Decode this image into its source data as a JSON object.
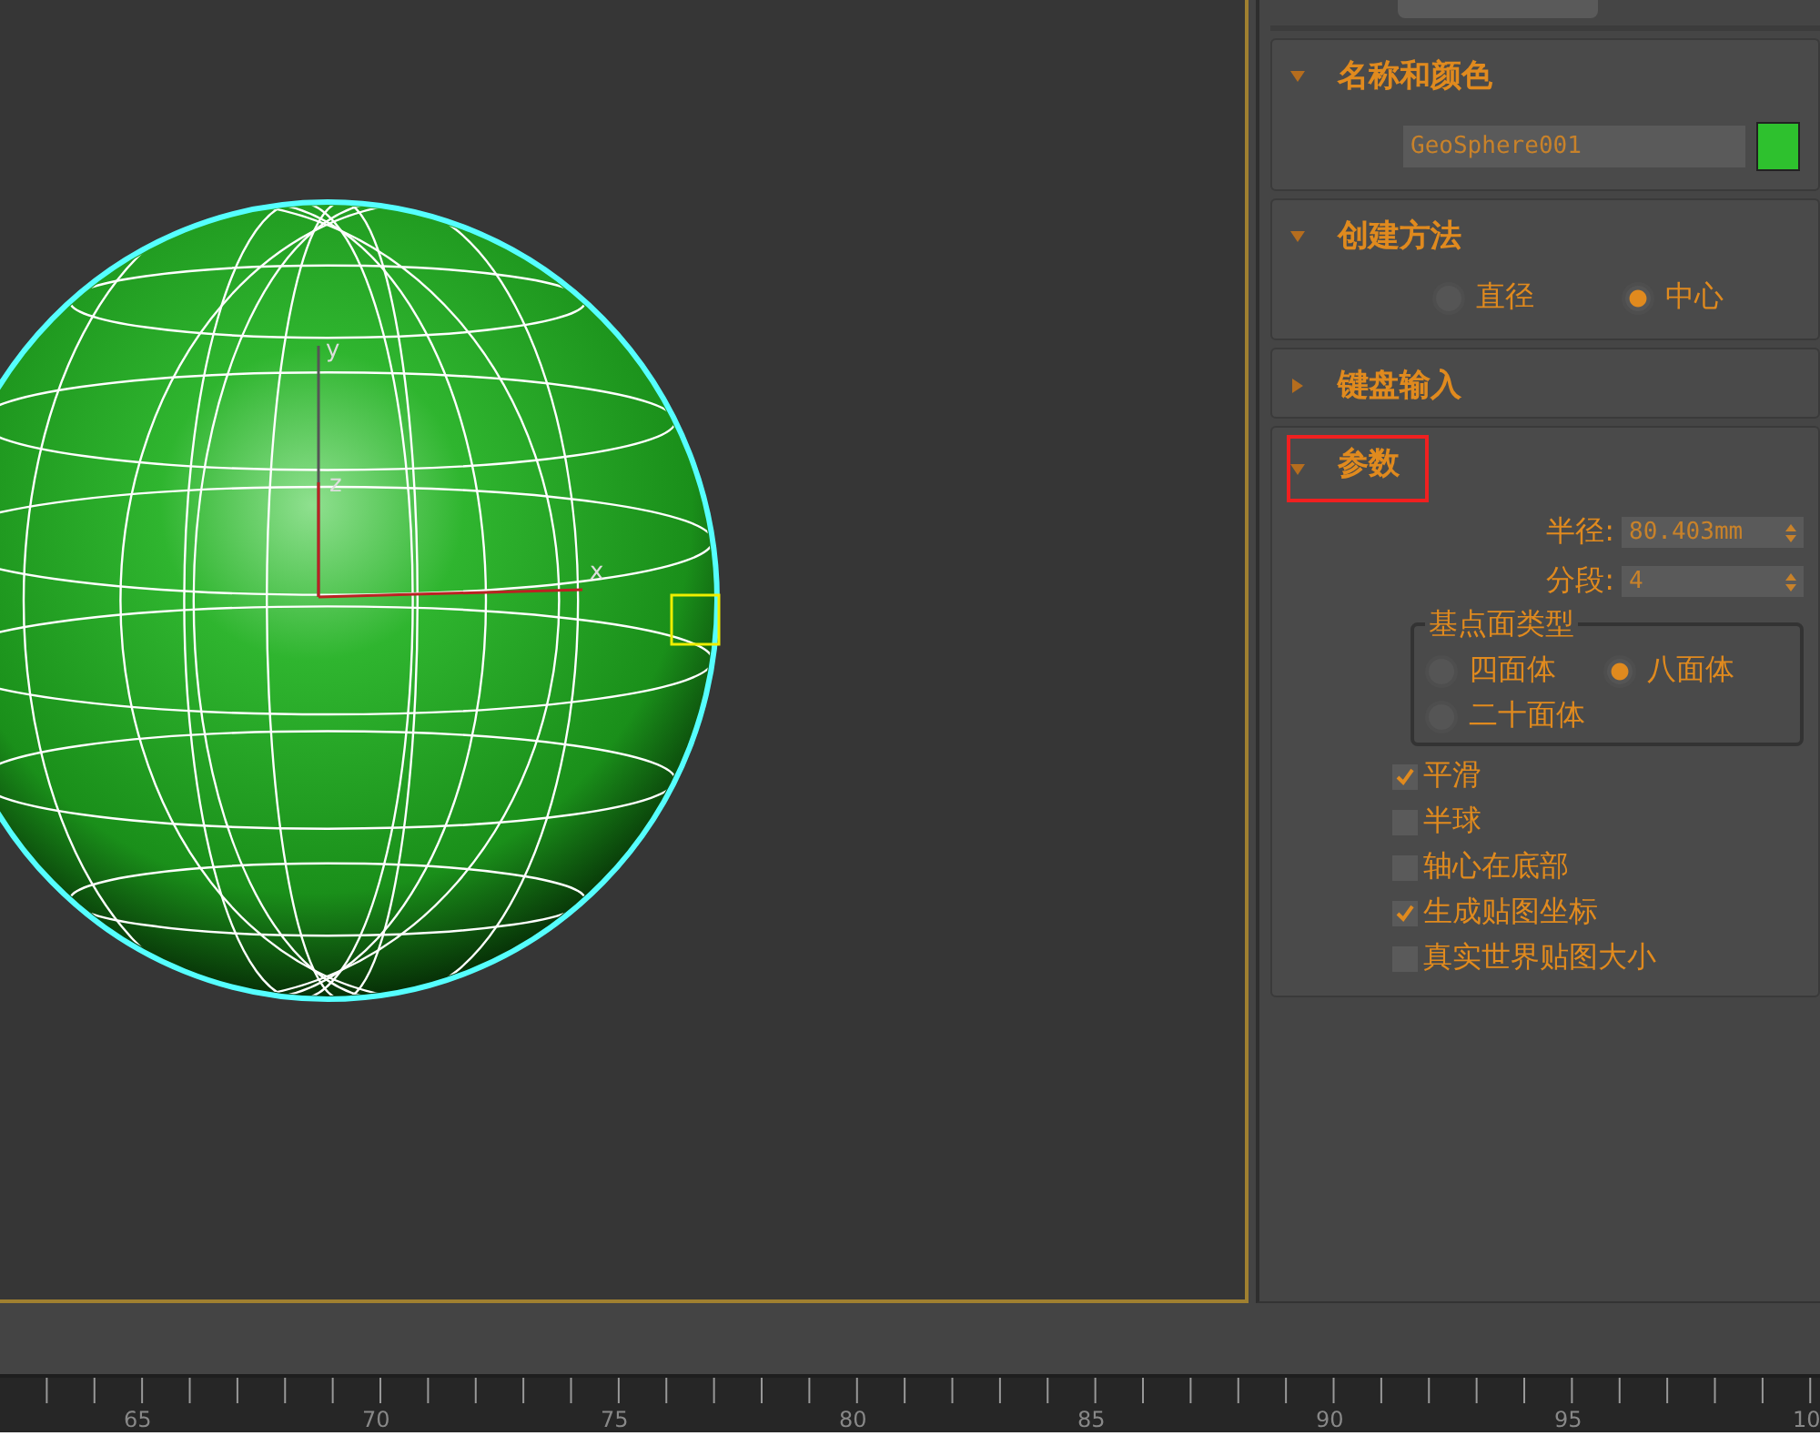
{
  "viewport": {
    "axis_labels": [
      "y",
      "z",
      "x"
    ]
  },
  "panel": {
    "rollouts": [
      {
        "kind": "name_color",
        "title": "名称和颜色",
        "expanded": true,
        "highlighted": false,
        "name": "GeoSphere001",
        "color": "#2ec12e"
      },
      {
        "kind": "radios",
        "title": "创建方法",
        "expanded": true,
        "highlighted": false,
        "options": [
          {
            "label": "直径",
            "selected": false
          },
          {
            "label": "中心",
            "selected": true
          }
        ]
      },
      {
        "kind": "empty",
        "title": "键盘输入",
        "expanded": false,
        "highlighted": false
      },
      {
        "kind": "params",
        "title": "参数",
        "expanded": true,
        "highlighted": true,
        "spinners": [
          {
            "label": "半径:",
            "value": "80.403mm"
          },
          {
            "label": "分段:",
            "value": "4"
          }
        ],
        "group": {
          "title": "基点面类型",
          "options": [
            {
              "label": "四面体",
              "selected": false
            },
            {
              "label": "八面体",
              "selected": true
            },
            {
              "label": "二十面体",
              "selected": false
            }
          ]
        },
        "checkboxes": [
          {
            "label": "平滑",
            "checked": true
          },
          {
            "label": "半球",
            "checked": false
          },
          {
            "label": "轴心在底部",
            "checked": false
          },
          {
            "label": "生成贴图坐标",
            "checked": true
          },
          {
            "label": "真实世界贴图大小",
            "checked": false
          }
        ]
      }
    ]
  },
  "ruler": {
    "labels": [
      "65",
      "70",
      "75",
      "80",
      "85",
      "90",
      "95",
      "10"
    ]
  }
}
